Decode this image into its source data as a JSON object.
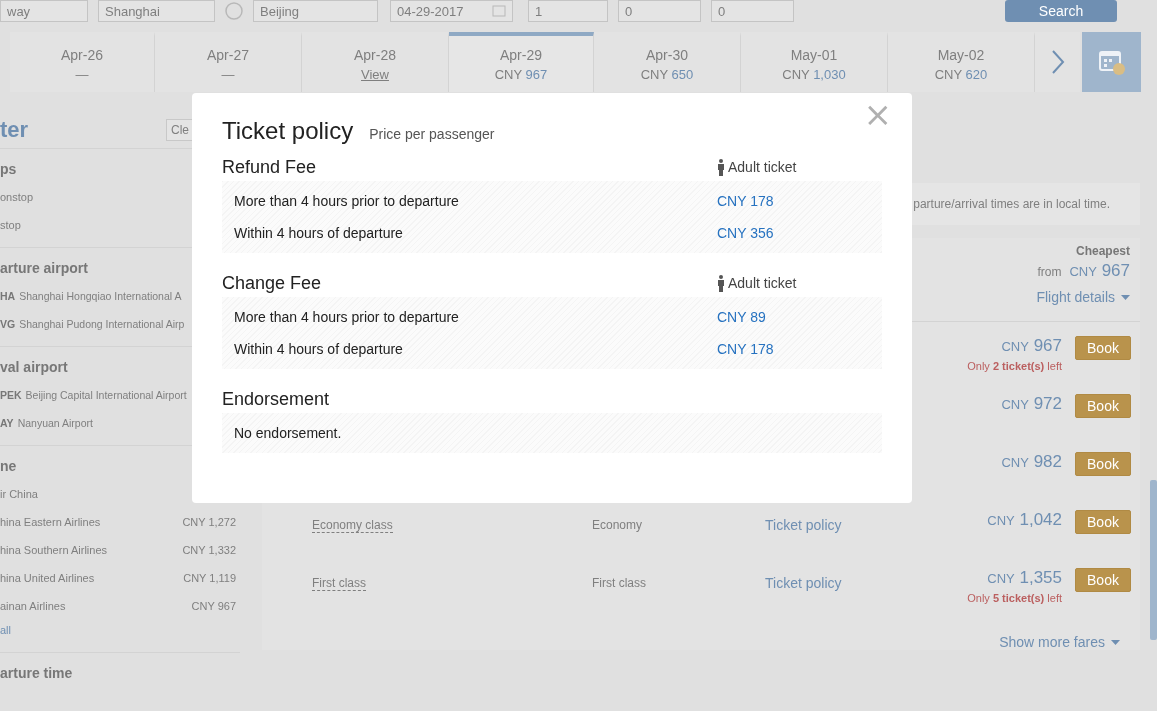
{
  "search_bar": {
    "trip_type": "way",
    "from": "Shanghai",
    "to": "Beijing",
    "date": "04-29-2017",
    "adults": "1",
    "children": "0",
    "infants": "0",
    "search_button": "Search"
  },
  "date_strip": {
    "dates": [
      {
        "date": "Apr-26",
        "kind": "none",
        "price": "—",
        "selected": false
      },
      {
        "date": "Apr-27",
        "kind": "none",
        "price": "—",
        "selected": false
      },
      {
        "date": "Apr-28",
        "kind": "link",
        "price": "View",
        "selected": false
      },
      {
        "date": "Apr-29",
        "kind": "price",
        "currency": "CNY",
        "price": "967",
        "selected": true
      },
      {
        "date": "Apr-30",
        "kind": "price",
        "currency": "CNY",
        "price": "650",
        "selected": false
      },
      {
        "date": "May-01",
        "kind": "price",
        "currency": "CNY",
        "price": "1,030",
        "selected": false
      },
      {
        "date": "May-02",
        "kind": "price",
        "currency": "CNY",
        "price": "620",
        "selected": false
      }
    ]
  },
  "filter": {
    "title": "ter",
    "clear_button": "Cle",
    "sections": [
      {
        "heading": "ps",
        "options": [
          {
            "label": "onstop"
          },
          {
            "label": "stop"
          }
        ]
      },
      {
        "heading": "arture airport",
        "options": [
          {
            "code": "HA",
            "label": "Shanghai Hongqiao International A"
          },
          {
            "code": "VG",
            "label": "Shanghai Pudong International Airp"
          }
        ]
      },
      {
        "heading": "val airport",
        "options": [
          {
            "code": "PEK",
            "label": "Beijing Capital International Airport"
          },
          {
            "code": "AY",
            "label": "Nanyuan Airport"
          }
        ]
      },
      {
        "heading": "ne",
        "options": [
          {
            "label": "ir China"
          },
          {
            "label": "hina Eastern Airlines",
            "price": "CNY 1,272"
          },
          {
            "label": "hina Southern Airlines",
            "price": "CNY 1,332"
          },
          {
            "label": "hina United Airlines",
            "price": "CNY 1,119"
          },
          {
            "label": "ainan Airlines",
            "price": "CNY 967"
          }
        ],
        "show_all": "all"
      },
      {
        "heading": "arture time"
      }
    ]
  },
  "notice": "parture/arrival times are in local time.",
  "flight": {
    "cheapest_label": "Cheapest",
    "from": "from",
    "currency": "CNY",
    "price": "967",
    "details_link": "Flight details",
    "fares": [
      {
        "currency": "CNY",
        "price": "967",
        "book": "Book",
        "remaining": "Only **2 ticket(s)** left"
      },
      {
        "currency": "CNY",
        "price": "972",
        "book": "Book"
      },
      {
        "currency": "CNY",
        "price": "982",
        "book": "Book"
      },
      {
        "class": "Economy class",
        "cabin": "Economy",
        "policy": "Ticket policy",
        "currency": "CNY",
        "price": "1,042",
        "book": "Book"
      },
      {
        "class": "First class",
        "cabin": "First class",
        "policy": "Ticket policy",
        "currency": "CNY",
        "price": "1,355",
        "book": "Book",
        "remaining": "Only **5 ticket(s)** left"
      }
    ],
    "more_fares": "Show more fares"
  },
  "modal": {
    "title": "Ticket policy",
    "subtitle": "Price per passenger",
    "close": "×",
    "sections": [
      {
        "heading": "Refund Fee",
        "passenger": "Adult ticket",
        "rows": [
          {
            "condition": "More than 4 hours prior to departure",
            "fee": "CNY 178"
          },
          {
            "condition": "Within 4 hours of departure",
            "fee": "CNY 356"
          }
        ]
      },
      {
        "heading": "Change Fee",
        "passenger": "Adult ticket",
        "rows": [
          {
            "condition": "More than 4 hours prior to departure",
            "fee": "CNY 89"
          },
          {
            "condition": "Within 4 hours of departure",
            "fee": "CNY 178"
          }
        ]
      },
      {
        "heading": "Endorsement",
        "rows": [
          {
            "condition": "No endorsement."
          }
        ]
      }
    ]
  }
}
